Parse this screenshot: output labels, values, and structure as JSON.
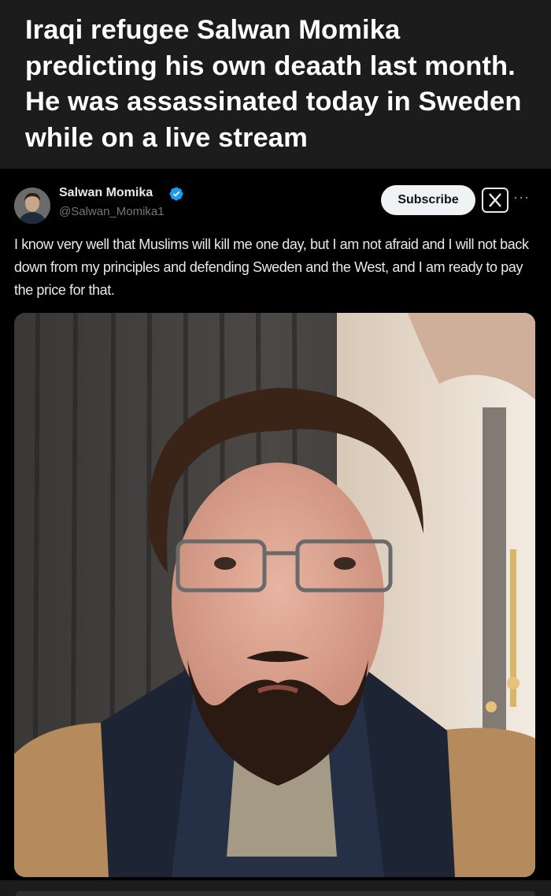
{
  "caption": {
    "text": "Iraqi refugee Salwan Momika predicting his own deaath last month. He was assassinated today in Sweden while on a live stream"
  },
  "post": {
    "author_name": "Salwan Momika",
    "author_handle": "@Salwan_Momika1",
    "verified": true,
    "subscribe_label": "Subscribe",
    "more_label": "···",
    "text": "I know very well that Muslims will kill me one day, but I am not afraid and I will not back down from my principles and defending Sweden and the West, and I am ready to pay the price for that.",
    "icons": [
      "verified-badge-icon",
      "x-logo-icon",
      "more-options-icon"
    ]
  },
  "colors": {
    "background": "#000000",
    "caption_background": "#1c1c1c",
    "verified_blue": "#1d9bf0",
    "text_primary": "#e7e9ea",
    "text_secondary": "#71767b"
  }
}
